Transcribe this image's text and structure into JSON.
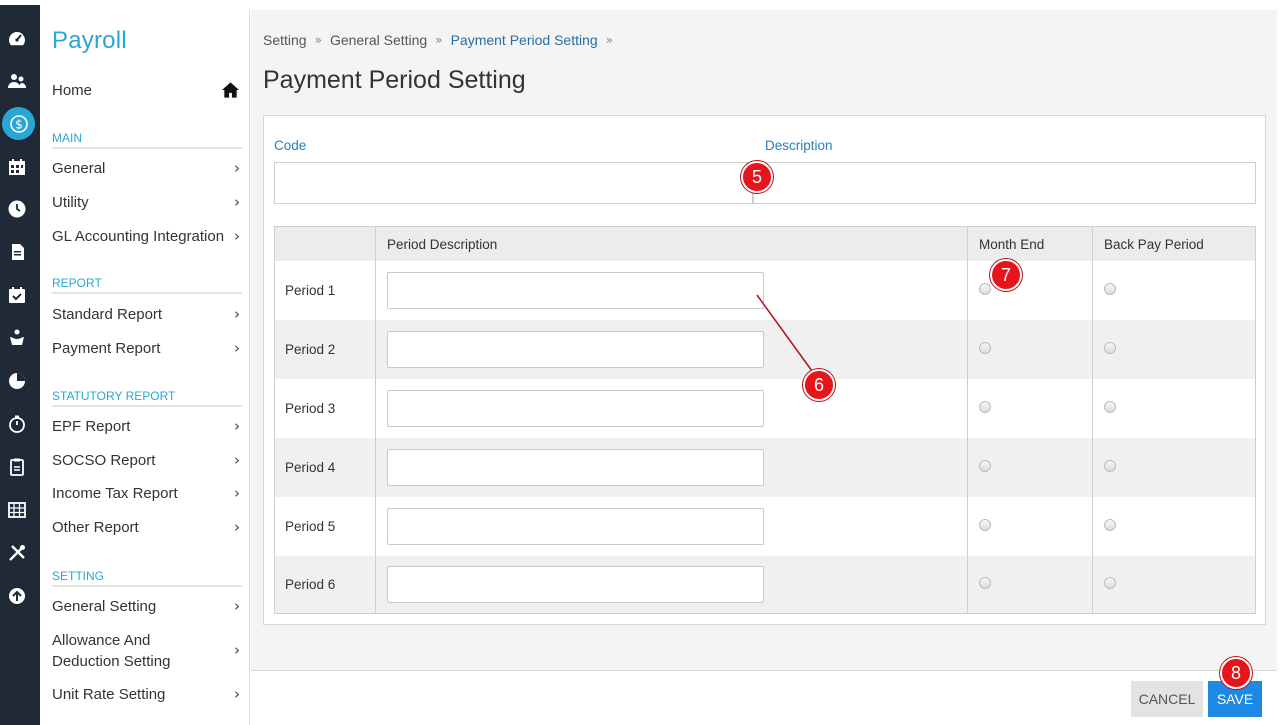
{
  "app": {
    "title": "Payroll"
  },
  "sidebar": {
    "home_label": "Home",
    "sections": [
      {
        "title": "MAIN",
        "items": [
          "General",
          "Utility",
          "GL Accounting Integration"
        ]
      },
      {
        "title": "REPORT",
        "items": [
          "Standard Report",
          "Payment Report"
        ]
      },
      {
        "title": "STATUTORY REPORT",
        "items": [
          "EPF Report",
          "SOCSO Report",
          "Income Tax Report",
          "Other Report"
        ]
      },
      {
        "title": "SETTING",
        "items": [
          "General Setting",
          "Allowance And Deduction Setting",
          "Unit Rate Setting"
        ]
      }
    ]
  },
  "rail": {
    "icons": [
      "dashboard-icon",
      "users-icon",
      "payroll-dollar-icon",
      "calendar-icon",
      "clock-icon",
      "document-icon",
      "calendar-check-icon",
      "hands-icon",
      "pie-chart-icon",
      "timer-icon",
      "clipboard-icon",
      "table-icon",
      "tools-icon",
      "upload-icon"
    ],
    "active": "payroll-dollar-icon"
  },
  "breadcrumb": [
    "Setting",
    "General Setting",
    "Payment Period Setting"
  ],
  "page_title": "Payment Period Setting",
  "form": {
    "code_label": "Code",
    "description_label": "Description",
    "code_value": "",
    "description_value": ""
  },
  "table": {
    "headers": [
      "",
      "Period Description",
      "Month End",
      "Back Pay Period"
    ],
    "rows": [
      {
        "label": "Period 1",
        "value": ""
      },
      {
        "label": "Period 2",
        "value": ""
      },
      {
        "label": "Period 3",
        "value": ""
      },
      {
        "label": "Period 4",
        "value": ""
      },
      {
        "label": "Period 5",
        "value": ""
      },
      {
        "label": "Period 6",
        "value": ""
      }
    ]
  },
  "footer": {
    "cancel_label": "CANCEL",
    "save_label": "SAVE"
  },
  "annotations": [
    "5",
    "6",
    "7",
    "8"
  ],
  "colors": {
    "accent": "#2aa6d6",
    "rail": "#1f2a36",
    "save": "#1e88e5",
    "callout": "#e8141b",
    "link": "#2a6ea5"
  }
}
